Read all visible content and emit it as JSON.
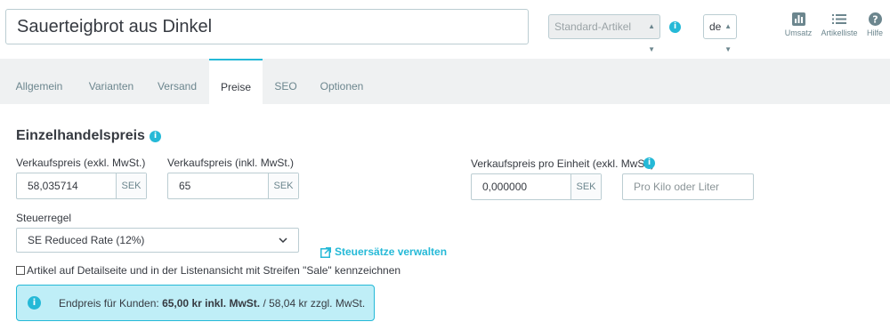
{
  "header": {
    "product_name": "Sauerteigbrot aus Dinkel",
    "product_type": "Standard-Artikel",
    "language": "de",
    "toolbar": [
      {
        "label": "Umsatz",
        "icon": "bar-chart-icon"
      },
      {
        "label": "Artikelliste",
        "icon": "list-icon"
      },
      {
        "label": "Hilfe",
        "icon": "help-icon"
      }
    ]
  },
  "tabs": [
    {
      "label": "Allgemein",
      "active": false
    },
    {
      "label": "Varianten",
      "active": false
    },
    {
      "label": "Versand",
      "active": false
    },
    {
      "label": "Preise",
      "active": true
    },
    {
      "label": "SEO",
      "active": false
    },
    {
      "label": "Optionen",
      "active": false
    }
  ],
  "pricing": {
    "title": "Einzelhandelspreis",
    "price_excl_label": "Verkaufspreis (exkl. MwSt.)",
    "price_excl_value": "58,035714",
    "price_incl_label": "Verkaufspreis (inkl. MwSt.)",
    "price_incl_value": "65",
    "currency": "SEK",
    "unit_price_label": "Verkaufspreis pro Einheit (exkl. MwSt.)",
    "unit_price_value": "0,000000",
    "unit_placeholder": "Pro Kilo oder Liter",
    "tax_rule_label": "Steuerregel",
    "tax_rule_value": "SE Reduced Rate (12%)",
    "manage_tax_link": "Steuersätze verwalten",
    "sale_checkbox_label": "Artikel auf Detailseite und in der Listenansicht mit Streifen \"Sale\" kennzeichnen",
    "sale_checked": false
  },
  "final_price": {
    "prefix": "Endpreis für Kunden: ",
    "incl": "65,00 kr inkl. MwSt.",
    "excl": " / 58,04 kr zzgl. MwSt."
  },
  "colors": {
    "accent": "#25b9d7",
    "alert_bg": "#bfeef7",
    "tab_bar_bg": "#eff1f2"
  }
}
